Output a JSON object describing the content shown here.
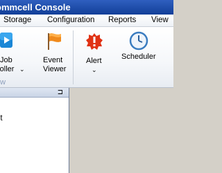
{
  "window": {
    "title": "ommcell Console"
  },
  "menu": {
    "items": [
      "Storage",
      "Configuration",
      "Reports",
      "View"
    ]
  },
  "ribbon": {
    "buttons": {
      "job_controller": {
        "line1": "Job",
        "line2": "roller"
      },
      "event_viewer": {
        "line1": "Event",
        "line2": "Viewer"
      },
      "alert": {
        "label": "Alert"
      },
      "scheduler": {
        "label": "Scheduler"
      }
    },
    "group_label": "ew"
  },
  "left_pane": {
    "pin_glyph": "⊐",
    "tree_text": "et"
  }
}
